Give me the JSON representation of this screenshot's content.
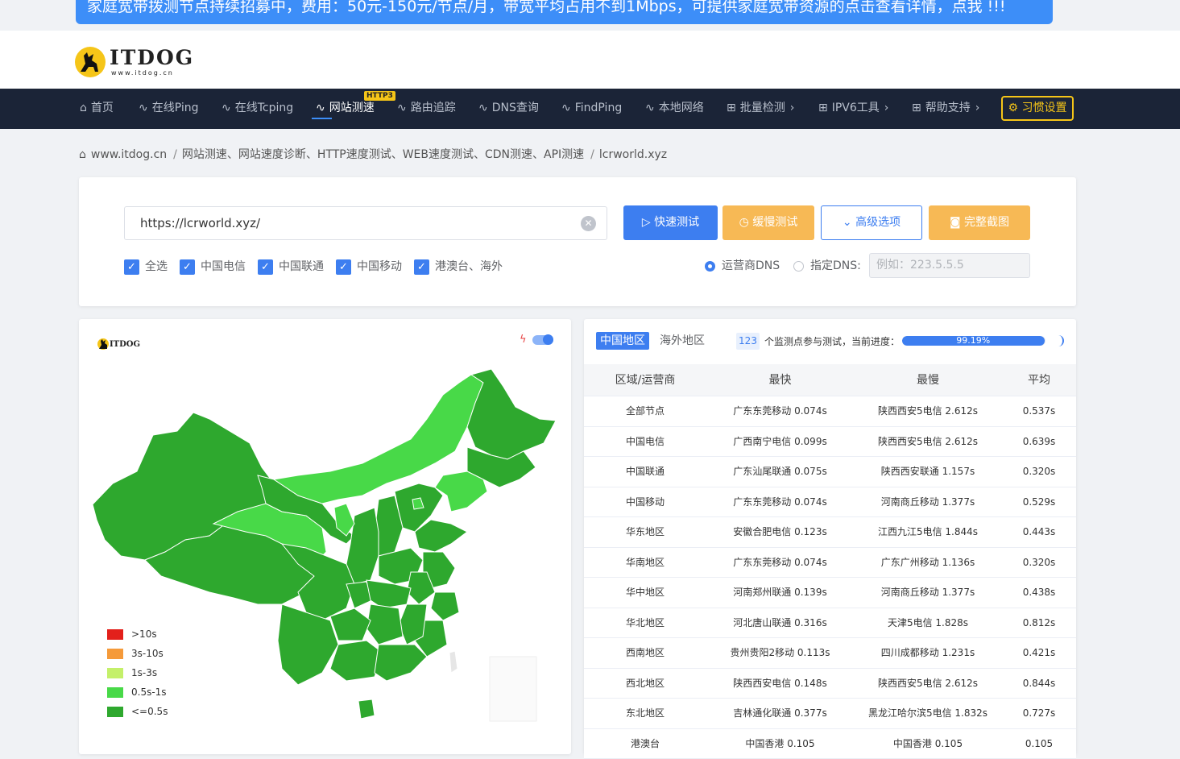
{
  "banner": {
    "text": "家庭宽带拨测节点持续招募中，费用：50元-150元/节点/月，带宽平均占用不到1Mbps，可提供家庭宽带资源的点击查看详情，点我 !!!"
  },
  "logo": {
    "text": "ITDOG",
    "sub": "www.itdog.cn"
  },
  "nav": {
    "items": [
      {
        "label": "首页",
        "icon": "home-icon"
      },
      {
        "label": "在线Ping",
        "icon": "pulse-icon"
      },
      {
        "label": "在线Tcping",
        "icon": "pulse-icon"
      },
      {
        "label": "网站测速",
        "icon": "pulse-icon"
      },
      {
        "label": "路由追踪",
        "icon": "pulse-icon"
      },
      {
        "label": "DNS查询",
        "icon": "pulse-icon"
      },
      {
        "label": "FindPing",
        "icon": "pulse-icon"
      },
      {
        "label": "本地网络",
        "icon": "pulse-icon"
      },
      {
        "label": "批量检测",
        "icon": "grid-icon"
      },
      {
        "label": "IPV6工具",
        "icon": "grid-icon"
      },
      {
        "label": "帮助支持",
        "icon": "grid-icon"
      }
    ],
    "badge": "HTTP3",
    "settings": "习惯设置"
  },
  "breadcrumb": [
    "www.itdog.cn",
    "网站测速、网站速度诊断、HTTP速度测试、WEB速度测试、CDN测速、API测速",
    "lcrworld.xyz"
  ],
  "form": {
    "url_value": "https://lcrworld.xyz/",
    "buttons": {
      "quick": "快速测试",
      "slow": "缓慢测试",
      "advanced": "高级选项",
      "screenshot": "完整截图"
    },
    "checkboxes": [
      "全选",
      "中国电信",
      "中国联通",
      "中国移动",
      "港澳台、海外"
    ],
    "dns": {
      "isp": "运营商DNS",
      "custom": "指定DNS:",
      "placeholder": "例如：223.5.5.5"
    }
  },
  "map": {
    "legend": [
      {
        "label": ">10s",
        "color": "#e3201b"
      },
      {
        "label": "3s-10s",
        "color": "#f59a3a"
      },
      {
        "label": "1s-3s",
        "color": "#c4f06a"
      },
      {
        "label": "0.5s-1s",
        "color": "#48d948"
      },
      {
        "label": "<=0.5s",
        "color": "#2ea82e"
      }
    ]
  },
  "results": {
    "tabs": {
      "china": "中国地区",
      "overseas": "海外地区"
    },
    "count": "123",
    "count_text": "个监测点参与测试，当前进度：",
    "progress": 99.19,
    "progress_label": "99.19%",
    "columns": [
      "区域/运营商",
      "最快",
      "最慢",
      "平均"
    ],
    "rows": [
      [
        "全部节点",
        "广东东莞移动 0.074s",
        "陕西西安5电信 2.612s",
        "0.537s"
      ],
      [
        "中国电信",
        "广西南宁电信 0.099s",
        "陕西西安5电信 2.612s",
        "0.639s"
      ],
      [
        "中国联通",
        "广东汕尾联通 0.075s",
        "陕西西安联通 1.157s",
        "0.320s"
      ],
      [
        "中国移动",
        "广东东莞移动 0.074s",
        "河南商丘移动 1.377s",
        "0.529s"
      ],
      [
        "华东地区",
        "安徽合肥电信 0.123s",
        "江西九江5电信 1.844s",
        "0.443s"
      ],
      [
        "华南地区",
        "广东东莞移动 0.074s",
        "广东广州移动 1.136s",
        "0.320s"
      ],
      [
        "华中地区",
        "河南郑州联通 0.139s",
        "河南商丘移动 1.377s",
        "0.438s"
      ],
      [
        "华北地区",
        "河北唐山联通 0.316s",
        "天津5电信 1.828s",
        "0.812s"
      ],
      [
        "西南地区",
        "贵州贵阳2移动 0.113s",
        "四川成都移动 1.231s",
        "0.421s"
      ],
      [
        "西北地区",
        "陕西西安电信 0.148s",
        "陕西西安5电信 2.612s",
        "0.844s"
      ],
      [
        "东北地区",
        "吉林通化联通 0.377s",
        "黑龙江哈尔滨5电信 1.832s",
        "0.727s"
      ],
      [
        "港澳台",
        "中国香港 0.105",
        "中国香港 0.105",
        "0.105"
      ]
    ]
  }
}
